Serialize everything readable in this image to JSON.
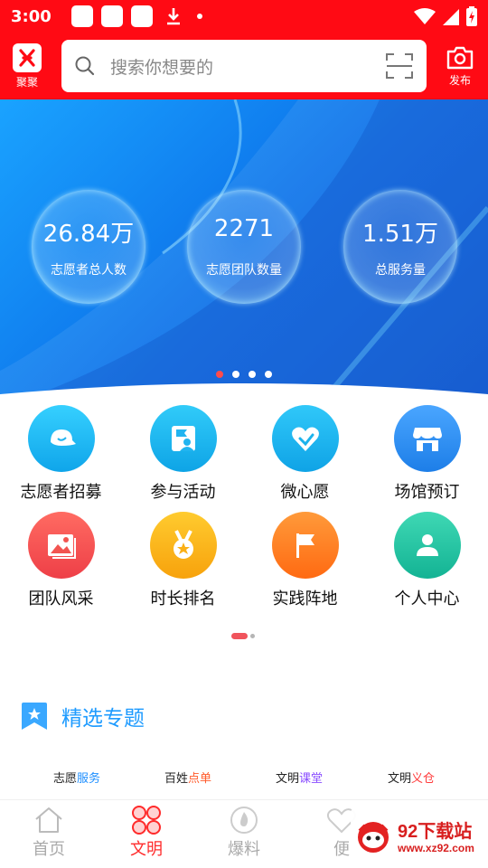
{
  "status_bar": {
    "time": "3:00"
  },
  "header": {
    "logo_label": "聚聚",
    "search_placeholder": "搜索你想要的",
    "publish_label": "发布"
  },
  "banner": {
    "stats": [
      {
        "value": "26.84万",
        "label": "志愿者总人数"
      },
      {
        "value": "2271",
        "label": "志愿团队数量"
      },
      {
        "value": "1.51万",
        "label": "总服务量"
      }
    ],
    "page_count": 4,
    "active_page": 1
  },
  "grid": {
    "items": [
      {
        "label": "志愿者招募",
        "icon": "cap-icon",
        "color": "#1ab8f5"
      },
      {
        "label": "参与活动",
        "icon": "activity-flag-icon",
        "color": "#17b3ea"
      },
      {
        "label": "微心愿",
        "icon": "heart-hand-icon",
        "color": "#1bb5ec"
      },
      {
        "label": "场馆预订",
        "icon": "store-icon",
        "color": "#2b8bf0"
      },
      {
        "label": "团队风采",
        "icon": "photo-icon",
        "color": "#f25450"
      },
      {
        "label": "时长排名",
        "icon": "medal-icon",
        "color": "#fbb016"
      },
      {
        "label": "实践阵地",
        "icon": "flag-icon",
        "color": "#ff7f1e"
      },
      {
        "label": "个人中心",
        "icon": "person-icon",
        "color": "#22c2a0"
      }
    ]
  },
  "section": {
    "title": "精选专题"
  },
  "cards": [
    {
      "prefix": "志愿",
      "highlight": "服务",
      "highlight_color": "#1e8fff"
    },
    {
      "prefix": "百姓",
      "highlight": "点单",
      "highlight_color": "#ff5a2a"
    },
    {
      "prefix": "文明",
      "highlight": "课堂",
      "highlight_color": "#8a4dff"
    },
    {
      "prefix": "文明",
      "highlight": "义仓",
      "highlight_color": "#ff3a3a"
    }
  ],
  "bottom_nav": {
    "items": [
      {
        "label": "首页",
        "icon": "home-icon"
      },
      {
        "label": "文明",
        "icon": "clover-icon",
        "active": true
      },
      {
        "label": "爆料",
        "icon": "fire-icon"
      },
      {
        "label": "便",
        "icon": "heart-outline-icon"
      }
    ]
  },
  "watermark": {
    "title": "92下载站",
    "url": "www.xz92.com"
  },
  "colors": {
    "brand_red": "#ff0a14",
    "accent_blue": "#1e9bff",
    "active_tab": "#ff2a2a"
  }
}
